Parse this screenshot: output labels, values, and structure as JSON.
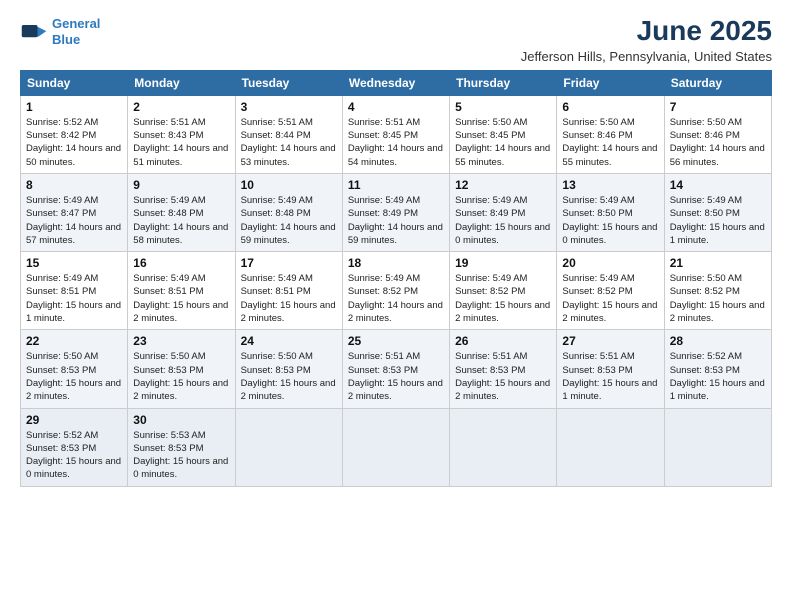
{
  "logo": {
    "line1": "General",
    "line2": "Blue"
  },
  "title": "June 2025",
  "subtitle": "Jefferson Hills, Pennsylvania, United States",
  "days_header": [
    "Sunday",
    "Monday",
    "Tuesday",
    "Wednesday",
    "Thursday",
    "Friday",
    "Saturday"
  ],
  "weeks": [
    [
      {
        "day": "1",
        "sunrise": "5:52 AM",
        "sunset": "8:42 PM",
        "daylight": "14 hours and 50 minutes."
      },
      {
        "day": "2",
        "sunrise": "5:51 AM",
        "sunset": "8:43 PM",
        "daylight": "14 hours and 51 minutes."
      },
      {
        "day": "3",
        "sunrise": "5:51 AM",
        "sunset": "8:44 PM",
        "daylight": "14 hours and 53 minutes."
      },
      {
        "day": "4",
        "sunrise": "5:51 AM",
        "sunset": "8:45 PM",
        "daylight": "14 hours and 54 minutes."
      },
      {
        "day": "5",
        "sunrise": "5:50 AM",
        "sunset": "8:45 PM",
        "daylight": "14 hours and 55 minutes."
      },
      {
        "day": "6",
        "sunrise": "5:50 AM",
        "sunset": "8:46 PM",
        "daylight": "14 hours and 55 minutes."
      },
      {
        "day": "7",
        "sunrise": "5:50 AM",
        "sunset": "8:46 PM",
        "daylight": "14 hours and 56 minutes."
      }
    ],
    [
      {
        "day": "8",
        "sunrise": "5:49 AM",
        "sunset": "8:47 PM",
        "daylight": "14 hours and 57 minutes."
      },
      {
        "day": "9",
        "sunrise": "5:49 AM",
        "sunset": "8:48 PM",
        "daylight": "14 hours and 58 minutes."
      },
      {
        "day": "10",
        "sunrise": "5:49 AM",
        "sunset": "8:48 PM",
        "daylight": "14 hours and 59 minutes."
      },
      {
        "day": "11",
        "sunrise": "5:49 AM",
        "sunset": "8:49 PM",
        "daylight": "14 hours and 59 minutes."
      },
      {
        "day": "12",
        "sunrise": "5:49 AM",
        "sunset": "8:49 PM",
        "daylight": "15 hours and 0 minutes."
      },
      {
        "day": "13",
        "sunrise": "5:49 AM",
        "sunset": "8:50 PM",
        "daylight": "15 hours and 0 minutes."
      },
      {
        "day": "14",
        "sunrise": "5:49 AM",
        "sunset": "8:50 PM",
        "daylight": "15 hours and 1 minute."
      }
    ],
    [
      {
        "day": "15",
        "sunrise": "5:49 AM",
        "sunset": "8:51 PM",
        "daylight": "15 hours and 1 minute."
      },
      {
        "day": "16",
        "sunrise": "5:49 AM",
        "sunset": "8:51 PM",
        "daylight": "15 hours and 2 minutes."
      },
      {
        "day": "17",
        "sunrise": "5:49 AM",
        "sunset": "8:51 PM",
        "daylight": "15 hours and 2 minutes."
      },
      {
        "day": "18",
        "sunrise": "5:49 AM",
        "sunset": "8:52 PM",
        "daylight": "14 hours and 2 minutes."
      },
      {
        "day": "19",
        "sunrise": "5:49 AM",
        "sunset": "8:52 PM",
        "daylight": "15 hours and 2 minutes."
      },
      {
        "day": "20",
        "sunrise": "5:49 AM",
        "sunset": "8:52 PM",
        "daylight": "15 hours and 2 minutes."
      },
      {
        "day": "21",
        "sunrise": "5:50 AM",
        "sunset": "8:52 PM",
        "daylight": "15 hours and 2 minutes."
      }
    ],
    [
      {
        "day": "22",
        "sunrise": "5:50 AM",
        "sunset": "8:53 PM",
        "daylight": "15 hours and 2 minutes."
      },
      {
        "day": "23",
        "sunrise": "5:50 AM",
        "sunset": "8:53 PM",
        "daylight": "15 hours and 2 minutes."
      },
      {
        "day": "24",
        "sunrise": "5:50 AM",
        "sunset": "8:53 PM",
        "daylight": "15 hours and 2 minutes."
      },
      {
        "day": "25",
        "sunrise": "5:51 AM",
        "sunset": "8:53 PM",
        "daylight": "15 hours and 2 minutes."
      },
      {
        "day": "26",
        "sunrise": "5:51 AM",
        "sunset": "8:53 PM",
        "daylight": "15 hours and 2 minutes."
      },
      {
        "day": "27",
        "sunrise": "5:51 AM",
        "sunset": "8:53 PM",
        "daylight": "15 hours and 1 minute."
      },
      {
        "day": "28",
        "sunrise": "5:52 AM",
        "sunset": "8:53 PM",
        "daylight": "15 hours and 1 minute."
      }
    ],
    [
      {
        "day": "29",
        "sunrise": "5:52 AM",
        "sunset": "8:53 PM",
        "daylight": "15 hours and 0 minutes."
      },
      {
        "day": "30",
        "sunrise": "5:53 AM",
        "sunset": "8:53 PM",
        "daylight": "15 hours and 0 minutes."
      },
      null,
      null,
      null,
      null,
      null
    ]
  ],
  "labels": {
    "sunrise": "Sunrise:",
    "sunset": "Sunset:",
    "daylight": "Daylight:"
  }
}
